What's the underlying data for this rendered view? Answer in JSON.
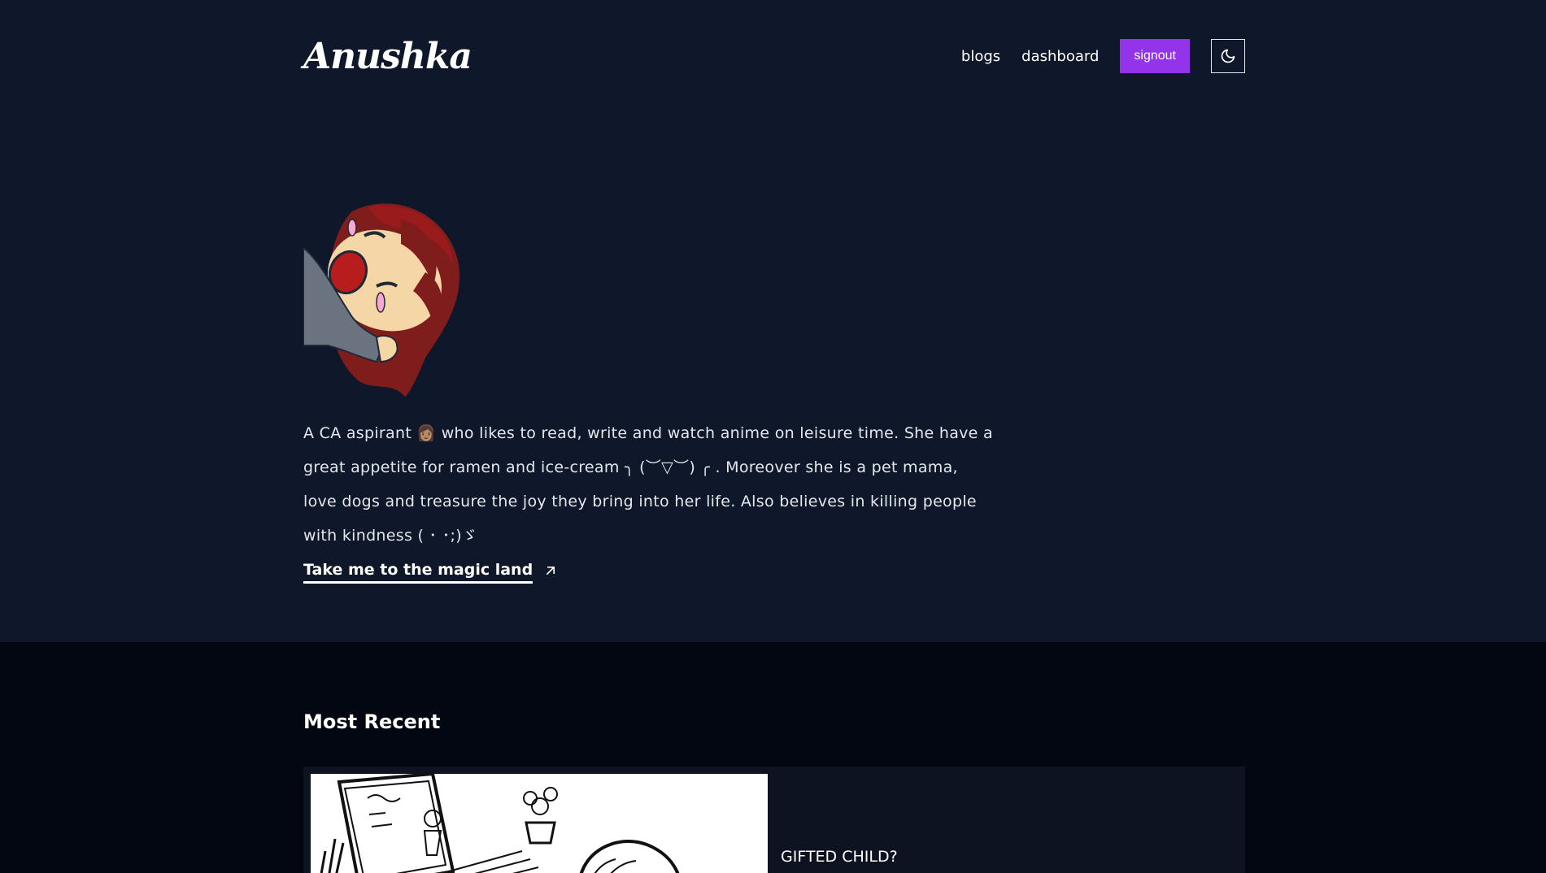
{
  "header": {
    "logo": "Anushka",
    "nav": [
      {
        "label": "blogs"
      },
      {
        "label": "dashboard"
      }
    ],
    "signout_label": "signout",
    "theme_icon": "moon-icon"
  },
  "hero": {
    "avatar_icon": "anime-avatar",
    "bio": "A CA aspirant 👩🏽 who likes to read, write and watch anime on leisure time. She have a great appetite for ramen and ice-cream ╮ (︶▽︶) ╭ . Moreover she is a pet mama, love dogs and treasure the joy they bring into her life. Also believes in killing people with kindness ( ･ ･;)ゞ",
    "link_label": "Take me to the magic land",
    "link_icon": "arrow-up-right-icon"
  },
  "recent": {
    "title": "Most Recent",
    "cards": [
      {
        "title": "GIFTED CHILD?"
      }
    ]
  },
  "colors": {
    "background": "#0f172a",
    "section_background": "#030712",
    "accent": "#9333ea"
  }
}
